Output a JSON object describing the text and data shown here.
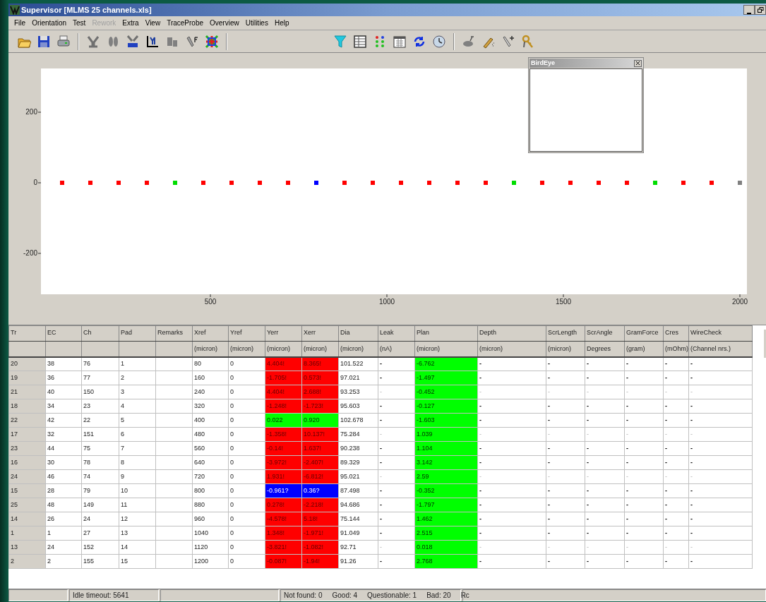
{
  "window": {
    "title": "Supervisor [MLMS 25 channels.xls]"
  },
  "menu": [
    {
      "label": "File",
      "disabled": false
    },
    {
      "label": "Orientation",
      "disabled": false
    },
    {
      "label": "Test",
      "disabled": false
    },
    {
      "label": "Rework",
      "disabled": true
    },
    {
      "label": "Extra",
      "disabled": false
    },
    {
      "label": "View",
      "disabled": false
    },
    {
      "label": "TraceProbe",
      "disabled": false
    },
    {
      "label": "Overview",
      "disabled": false
    },
    {
      "label": "Utilities",
      "disabled": false
    },
    {
      "label": "Help",
      "disabled": false
    }
  ],
  "chart": {
    "chart_data": {
      "type": "scatter",
      "x": [
        80,
        160,
        240,
        320,
        400,
        480,
        560,
        640,
        720,
        800,
        880,
        960,
        1040,
        1120,
        1200,
        1280,
        1360,
        1440,
        1520,
        1600,
        1680,
        1760,
        1840,
        1920,
        2000
      ],
      "series": [
        {
          "color": "#ff0000",
          "values": [
            0,
            0,
            0,
            0,
            null,
            0,
            0,
            0,
            0,
            null,
            0,
            0,
            0,
            0,
            0,
            0,
            null,
            0,
            0,
            0,
            0,
            null,
            0,
            0,
            null
          ]
        },
        {
          "color": "#00dd00",
          "values": [
            null,
            null,
            null,
            null,
            0,
            null,
            null,
            null,
            null,
            null,
            null,
            null,
            null,
            null,
            null,
            null,
            0,
            null,
            null,
            null,
            null,
            0,
            null,
            null,
            null
          ]
        },
        {
          "color": "#0000ff",
          "values": [
            null,
            null,
            null,
            null,
            null,
            null,
            null,
            null,
            null,
            0,
            null,
            null,
            null,
            null,
            null,
            null,
            null,
            null,
            null,
            null,
            null,
            null,
            null,
            null,
            null
          ]
        },
        {
          "color": "#808080",
          "values": [
            null,
            null,
            null,
            null,
            null,
            null,
            null,
            null,
            null,
            null,
            null,
            null,
            null,
            null,
            null,
            null,
            null,
            null,
            null,
            null,
            null,
            null,
            null,
            null,
            0
          ]
        }
      ],
      "xlim": [
        20,
        2020
      ],
      "ylim": [
        -316,
        324
      ],
      "xticks": [
        500,
        1000,
        1500,
        2000
      ],
      "yticks": [
        -200,
        0,
        200
      ]
    }
  },
  "bird_eye": {
    "title": "BirdEye"
  },
  "table": {
    "columns": [
      {
        "title": "Tr"
      },
      {
        "title": "EC"
      },
      {
        "title": "Ch"
      },
      {
        "title": "Pad"
      },
      {
        "title": "Remarks"
      },
      {
        "title": "Xref",
        "unit": "(micron)"
      },
      {
        "title": "Yref",
        "unit": "(micron)"
      },
      {
        "title": "Yerr",
        "unit": "(micron)"
      },
      {
        "title": "Xerr",
        "unit": "(micron)"
      },
      {
        "title": "Dia",
        "unit": "(micron)"
      },
      {
        "title": "Leak",
        "unit": "(nA)"
      },
      {
        "title": "Plan",
        "unit": "(micron)"
      },
      {
        "title": "Depth",
        "unit": "(micron)"
      },
      {
        "title": "ScrLength",
        "unit": "(micron)"
      },
      {
        "title": "ScrAngle",
        "unit": "Degrees"
      },
      {
        "title": "GramForce",
        "unit": "(gram)"
      },
      {
        "title": "Cres",
        "unit": "(mOhm)"
      },
      {
        "title": "WireCheck",
        "unit": "(Channel nrs.)"
      }
    ],
    "rows": [
      {
        "tr": "20",
        "ec": "38",
        "ch": "76",
        "pad": "1",
        "xref": "80",
        "yref": "0",
        "yerr": "4.404!",
        "xerr": "8.365!",
        "dia": "101.522",
        "leak": "-",
        "plan": "-6.762",
        "depth": "-",
        "scr_length": "-",
        "scr_angle": "-",
        "gram_force": "-",
        "cres": "-",
        "wire_check": "-",
        "ok": false,
        "questionable": false,
        "plan_ok": true,
        "greyed": false
      },
      {
        "tr": "19",
        "ec": "36",
        "ch": "77",
        "pad": "2",
        "xref": "160",
        "yref": "0",
        "yerr": "-1.705!",
        "xerr": "0.573!",
        "dia": "97.021",
        "leak": "-",
        "plan": "-1.497",
        "depth": "-",
        "scr_length": "-",
        "scr_angle": "-",
        "gram_force": "-",
        "cres": "-",
        "wire_check": "-",
        "ok": false,
        "questionable": false,
        "plan_ok": true,
        "greyed": false
      },
      {
        "tr": "21",
        "ec": "40",
        "ch": "150",
        "pad": "3",
        "xref": "240",
        "yref": "0",
        "yerr": "4.404!",
        "xerr": "2.688!",
        "dia": "93.253",
        "leak": "-",
        "plan": "-0.452",
        "depth": "-",
        "scr_length": "-",
        "scr_angle": "-",
        "gram_force": "-",
        "cres": "-",
        "wire_check": "-",
        "ok": false,
        "questionable": false,
        "plan_ok": true,
        "greyed": true
      },
      {
        "tr": "18",
        "ec": "34",
        "ch": "23",
        "pad": "4",
        "xref": "320",
        "yref": "0",
        "yerr": "-1.248!",
        "xerr": "-1.723!",
        "dia": "95.603",
        "leak": "-",
        "plan": "-0.127",
        "depth": "-",
        "scr_length": "-",
        "scr_angle": "-",
        "gram_force": "-",
        "cres": "-",
        "wire_check": "-",
        "ok": false,
        "questionable": false,
        "plan_ok": true,
        "greyed": false
      },
      {
        "tr": "22",
        "ec": "42",
        "ch": "22",
        "pad": "5",
        "xref": "400",
        "yref": "0",
        "yerr": "0.022",
        "xerr": "0.920",
        "dia": "102.678",
        "leak": "-",
        "plan": "-1.603",
        "depth": "-",
        "scr_length": "-",
        "scr_angle": "-",
        "gram_force": "-",
        "cres": "-",
        "wire_check": "-",
        "ok": true,
        "questionable": false,
        "plan_ok": true,
        "greyed": false
      },
      {
        "tr": "17",
        "ec": "32",
        "ch": "151",
        "pad": "6",
        "xref": "480",
        "yref": "0",
        "yerr": "-1.358!",
        "xerr": "10.137!",
        "dia": "75.284",
        "leak": "-",
        "plan": "1.039",
        "depth": "-",
        "scr_length": "-",
        "scr_angle": "-",
        "gram_force": "-",
        "cres": "-",
        "wire_check": "-",
        "ok": false,
        "questionable": false,
        "plan_ok": true,
        "greyed": true
      },
      {
        "tr": "23",
        "ec": "44",
        "ch": "75",
        "pad": "7",
        "xref": "560",
        "yref": "0",
        "yerr": "-0.14!",
        "xerr": "1.637!",
        "dia": "90.238",
        "leak": "-",
        "plan": "1.104",
        "depth": "-",
        "scr_length": "-",
        "scr_angle": "-",
        "gram_force": "-",
        "cres": "-",
        "wire_check": "-",
        "ok": false,
        "questionable": false,
        "plan_ok": true,
        "greyed": false
      },
      {
        "tr": "16",
        "ec": "30",
        "ch": "78",
        "pad": "8",
        "xref": "640",
        "yref": "0",
        "yerr": "-3.972!",
        "xerr": "-2.407!",
        "dia": "89.329",
        "leak": "-",
        "plan": "3.142",
        "depth": "-",
        "scr_length": "-",
        "scr_angle": "-",
        "gram_force": "-",
        "cres": "-",
        "wire_check": "-",
        "ok": false,
        "questionable": false,
        "plan_ok": true,
        "greyed": false
      },
      {
        "tr": "24",
        "ec": "46",
        "ch": "74",
        "pad": "9",
        "xref": "720",
        "yref": "0",
        "yerr": "1.931!",
        "xerr": "-6.812!",
        "dia": "95.021",
        "leak": "-",
        "plan": "2.59",
        "depth": "-",
        "scr_length": "-",
        "scr_angle": "-",
        "gram_force": "-",
        "cres": "-",
        "wire_check": "-",
        "ok": false,
        "questionable": false,
        "plan_ok": true,
        "greyed": true
      },
      {
        "tr": "15",
        "ec": "28",
        "ch": "79",
        "pad": "10",
        "xref": "800",
        "yref": "0",
        "yerr": "-0.961?",
        "xerr": "0.36?",
        "dia": "87.498",
        "leak": "-",
        "plan": "-0.352",
        "depth": "-",
        "scr_length": "-",
        "scr_angle": "-",
        "gram_force": "-",
        "cres": "-",
        "wire_check": "-",
        "ok": false,
        "questionable": true,
        "plan_ok": true,
        "greyed": false
      },
      {
        "tr": "25",
        "ec": "48",
        "ch": "149",
        "pad": "11",
        "xref": "880",
        "yref": "0",
        "yerr": "0.278!",
        "xerr": "-2.218!",
        "dia": "94.686",
        "leak": "-",
        "plan": "-1.797",
        "depth": "-",
        "scr_length": "-",
        "scr_angle": "-",
        "gram_force": "-",
        "cres": "-",
        "wire_check": "-",
        "ok": false,
        "questionable": false,
        "plan_ok": true,
        "greyed": false
      },
      {
        "tr": "14",
        "ec": "26",
        "ch": "24",
        "pad": "12",
        "xref": "960",
        "yref": "0",
        "yerr": "-4.578!",
        "xerr": "5.18!",
        "dia": "75.144",
        "leak": "-",
        "plan": "1.462",
        "depth": "-",
        "scr_length": "-",
        "scr_angle": "-",
        "gram_force": "-",
        "cres": "-",
        "wire_check": "-",
        "ok": false,
        "questionable": false,
        "plan_ok": true,
        "greyed": false
      },
      {
        "tr": "1",
        "ec": "1",
        "ch": "27",
        "pad": "13",
        "xref": "1040",
        "yref": "0",
        "yerr": "1.348!",
        "xerr": "-1.971!",
        "dia": "91.049",
        "leak": "-",
        "plan": "2.515",
        "depth": "-",
        "scr_length": "-",
        "scr_angle": "-",
        "gram_force": "-",
        "cres": "-",
        "wire_check": "-",
        "ok": false,
        "questionable": false,
        "plan_ok": true,
        "greyed": false
      },
      {
        "tr": "13",
        "ec": "24",
        "ch": "152",
        "pad": "14",
        "xref": "1120",
        "yref": "0",
        "yerr": "-3.821!",
        "xerr": "-1.082!",
        "dia": "92.71",
        "leak": "-",
        "plan": "0.018",
        "depth": "-",
        "scr_length": "-",
        "scr_angle": "-",
        "gram_force": "-",
        "cres": "-",
        "wire_check": "-",
        "ok": false,
        "questionable": false,
        "plan_ok": true,
        "greyed": true
      },
      {
        "tr": "2",
        "ec": "2",
        "ch": "155",
        "pad": "15",
        "xref": "1200",
        "yref": "0",
        "yerr": "-0.087!",
        "xerr": "-1.94!",
        "dia": "91.26",
        "leak": "-",
        "plan": "2.768",
        "depth": "-",
        "scr_length": "-",
        "scr_angle": "-",
        "gram_force": "-",
        "cres": "-",
        "wire_check": "-",
        "ok": false,
        "questionable": false,
        "plan_ok": true,
        "greyed": false
      }
    ]
  },
  "status_bar": {
    "idle": "Idle timeout: 5641",
    "counts": [
      "Not found: 0",
      "Good: 4",
      "Questionable: 1",
      "Bad: 20",
      "Rc"
    ]
  }
}
